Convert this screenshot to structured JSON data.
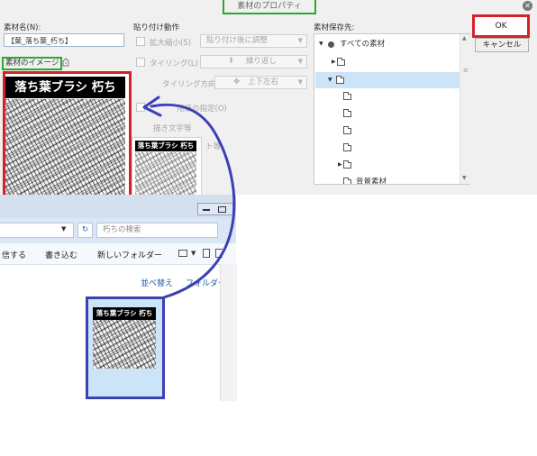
{
  "dialog": {
    "title": "素材のプロパティ",
    "close_icon": "close-icon",
    "name_label": "素材名(N):",
    "name_value": "【葉_落ち葉_朽ち】",
    "image_label": "素材のイメージ",
    "paste": {
      "header": "貼り付け動作",
      "scale_label": "拡大縮小(S)",
      "scale_value": "貼り付け後に調整",
      "tiling_label": "タイリング(L)",
      "tiling_value": "繰り返し",
      "direction_label": "タイリング方向:",
      "direction_value": "上下左右",
      "specify_label": "用紙の指定(O)",
      "draw_label": "描き文字等",
      "extra_label": "ト等"
    },
    "preview_header": "落ち葉ブラシ 朽ち",
    "thumb_header": "落ち葉ブラシ 朽ち",
    "save_dest": {
      "label": "素材保存先:",
      "root": "すべての素材",
      "partial_item": "背景素材"
    },
    "ok_label": "OK",
    "cancel_label": "キャンセル"
  },
  "explorer": {
    "search_placeholder": "朽ちの検索",
    "toolbar": {
      "partial_share": "信する",
      "write": "書き込む",
      "new_folder": "新しいフォルダー"
    },
    "sort_label": "並べ替え",
    "folder_label": "フォルダー",
    "file_header": "落ち葉ブラシ 朽ち"
  },
  "colors": {
    "annotation_red": "#d8202a",
    "annotation_green": "#2ba82f",
    "annotation_blue": "#3d3fb5",
    "selection": "#cce4f7"
  }
}
